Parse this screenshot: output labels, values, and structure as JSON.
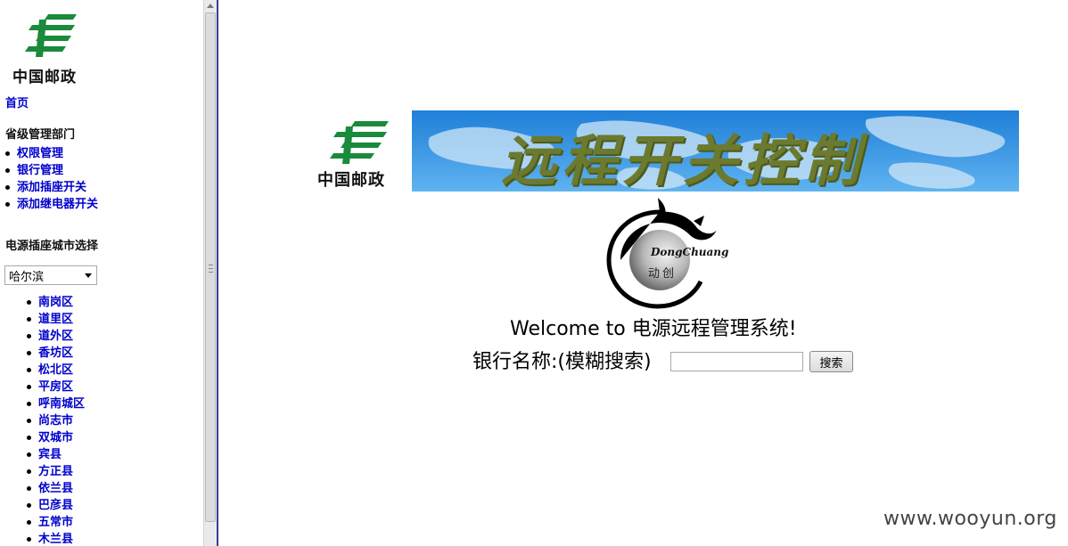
{
  "sidebar": {
    "logo_text": "中国邮政",
    "home_label": "首页",
    "admin_section_title": "省级管理部门",
    "admin_items": [
      {
        "label": "权限管理"
      },
      {
        "label": "银行管理"
      },
      {
        "label": "添加插座开关"
      },
      {
        "label": "添加继电器开关"
      }
    ],
    "city_section_title": "电源插座城市选择",
    "city_select_value": "哈尔滨",
    "districts": [
      {
        "label": "南岗区"
      },
      {
        "label": "道里区"
      },
      {
        "label": "道外区"
      },
      {
        "label": "香坊区"
      },
      {
        "label": "松北区"
      },
      {
        "label": "平房区"
      },
      {
        "label": "呼南城区"
      },
      {
        "label": "尚志市"
      },
      {
        "label": "双城市"
      },
      {
        "label": "宾县"
      },
      {
        "label": "方正县"
      },
      {
        "label": "依兰县"
      },
      {
        "label": "巴彦县"
      },
      {
        "label": "五常市"
      },
      {
        "label": "木兰县"
      }
    ]
  },
  "main": {
    "banner_logo_text": "中国邮政",
    "banner_title": "远程开关控制",
    "brand_en": "DongChuang",
    "brand_cn": "动创",
    "welcome_text": "Welcome to 电源远程管理系统!",
    "search_label": "银行名称:(模糊搜索)",
    "search_value": "",
    "search_button_label": "搜索"
  },
  "watermark": "www.wooyun.org",
  "colors": {
    "link": "#0000cc",
    "post_green": "#1a8a3c",
    "banner_sky": "#2e8fe0",
    "banner_text": "#6b7a2e"
  }
}
